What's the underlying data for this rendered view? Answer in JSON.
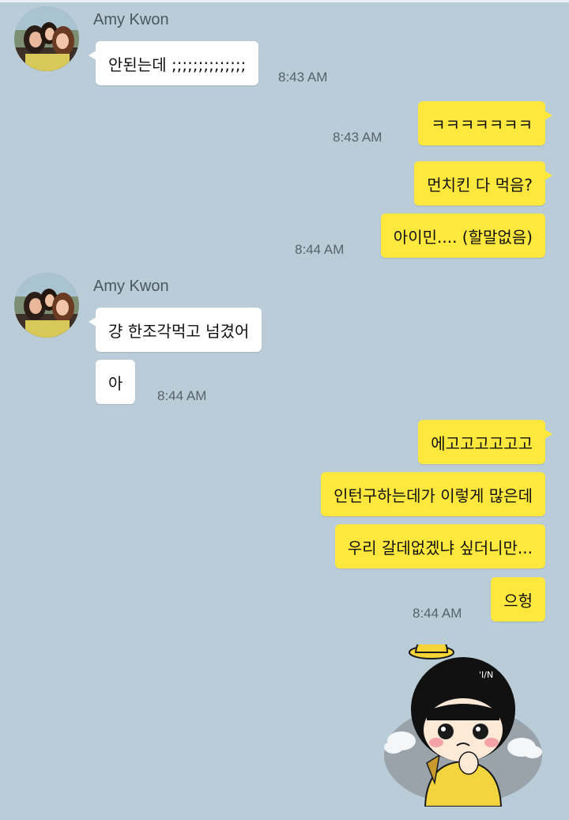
{
  "chat": {
    "sender_name": "Amy Kwon",
    "messages": [
      {
        "text": "안된는데 ;;;;;;;;;;;;;;",
        "time": "8:43 AM"
      },
      {
        "text": "ㅋㅋㅋㅋㅋㅋㅋ",
        "time": "8:43 AM"
      },
      {
        "text": "먼치킨 다 먹음?"
      },
      {
        "text": "아이민.... (할말없음)",
        "time": "8:44 AM"
      },
      {
        "text": "걍 한조각먹고 넘겼어"
      },
      {
        "text": "아",
        "time": "8:44 AM"
      },
      {
        "text": "에고고고고고고"
      },
      {
        "text": "인턴구하는데가 이렇게 많은데"
      },
      {
        "text": "우리 갈데없겠냐 싶더니만..."
      },
      {
        "text": "으헝",
        "time": "8:44 AM"
      }
    ],
    "sticker": {
      "name": "crying-girl-sticker",
      "text": "'I/N"
    }
  },
  "colors": {
    "background": "#b9ccd8",
    "outgoing_bubble": "#fee83e",
    "incoming_bubble": "#ffffff"
  }
}
